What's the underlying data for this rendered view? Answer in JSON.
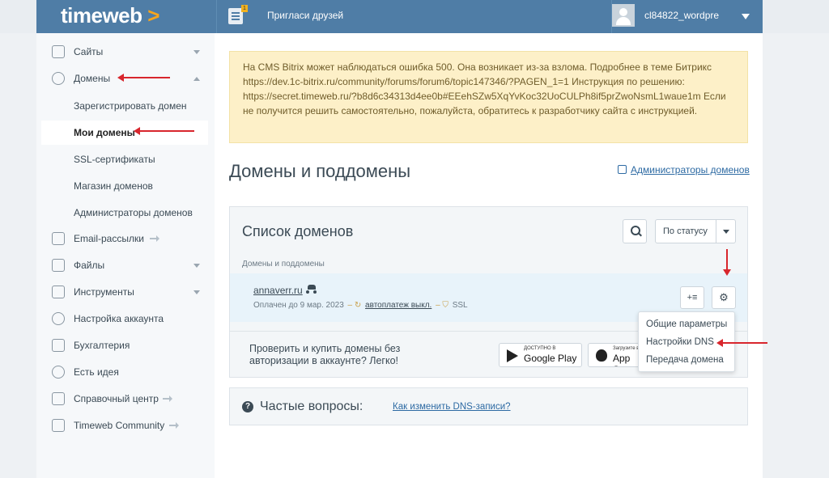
{
  "brand": {
    "name": "timeweb",
    "chevron": ">",
    "accent": "#f7a51c",
    "header_color": "#4f7da6"
  },
  "header": {
    "invite_label": "Пригласи друзей",
    "invite_badge": "1",
    "username": "cl84822_wordpre"
  },
  "sidebar": {
    "items": [
      {
        "label": "Сайты",
        "icon": "monitor-icon"
      },
      {
        "label": "Домены",
        "icon": "globe-icon"
      },
      {
        "label": "Email-рассылки",
        "icon": "mail-icon"
      },
      {
        "label": "Файлы",
        "icon": "folder-icon"
      },
      {
        "label": "Инструменты",
        "icon": "sliders-icon"
      },
      {
        "label": "Настройка аккаунта",
        "icon": "gear-icon"
      },
      {
        "label": "Бухгалтерия",
        "icon": "ledger-icon"
      },
      {
        "label": "Есть идея",
        "icon": "lightbulb-icon"
      },
      {
        "label": "Справочный центр",
        "icon": "help-icon"
      },
      {
        "label": "Timeweb Community",
        "icon": "chat-icon"
      }
    ],
    "domains_sub": [
      "Зарегистрировать домен",
      "Мои домены",
      "SSL-сертификаты",
      "Магазин доменов",
      "Администраторы доменов"
    ]
  },
  "alert": {
    "text": "На CMS Bitrix может наблюдаться ошибка 500. Она возникает из-за взлома. Подробнее в теме Битрикс https://dev.1c-bitrix.ru/community/forums/forum6/topic147346/?PAGEN_1=1 Инструкция по решению: https://secret.timeweb.ru/?b8d6c34313d4ee0b#EEehSZw5XqYvKoc32UoCULPh8if5prZwoNsmL1waue1m Если не получится решить самостоятельно, пожалуйста, обратитесь к разработчику сайта с инструкцией."
  },
  "main": {
    "title": "Домены и поддомены",
    "admins_link": "Администраторы доменов"
  },
  "domains_panel": {
    "title": "Список доменов",
    "status_filter": "По статусу",
    "column_header": "Домены и поддомены",
    "row": {
      "name": "annaverr.ru",
      "paid_until": "Оплачен до 9 мар. 2023",
      "autopay": "автоплатеж выкл.",
      "ssl": "SSL"
    },
    "sort_glyph": "+≡",
    "gear_glyph": "⚙"
  },
  "dropdown": {
    "items": [
      "Общие параметры",
      "Настройки DNS",
      "Передача домена"
    ]
  },
  "promo": {
    "text": "Проверить и купить домены без авторизации в аккаунте? Легко!",
    "google_small": "ДОСТУПНО В",
    "google_big": "Google Play",
    "apple_small": "Загрузите в",
    "apple_big": "App Store"
  },
  "faq": {
    "label": "Частые вопросы:",
    "link": "Как изменить DNS-записи?"
  }
}
